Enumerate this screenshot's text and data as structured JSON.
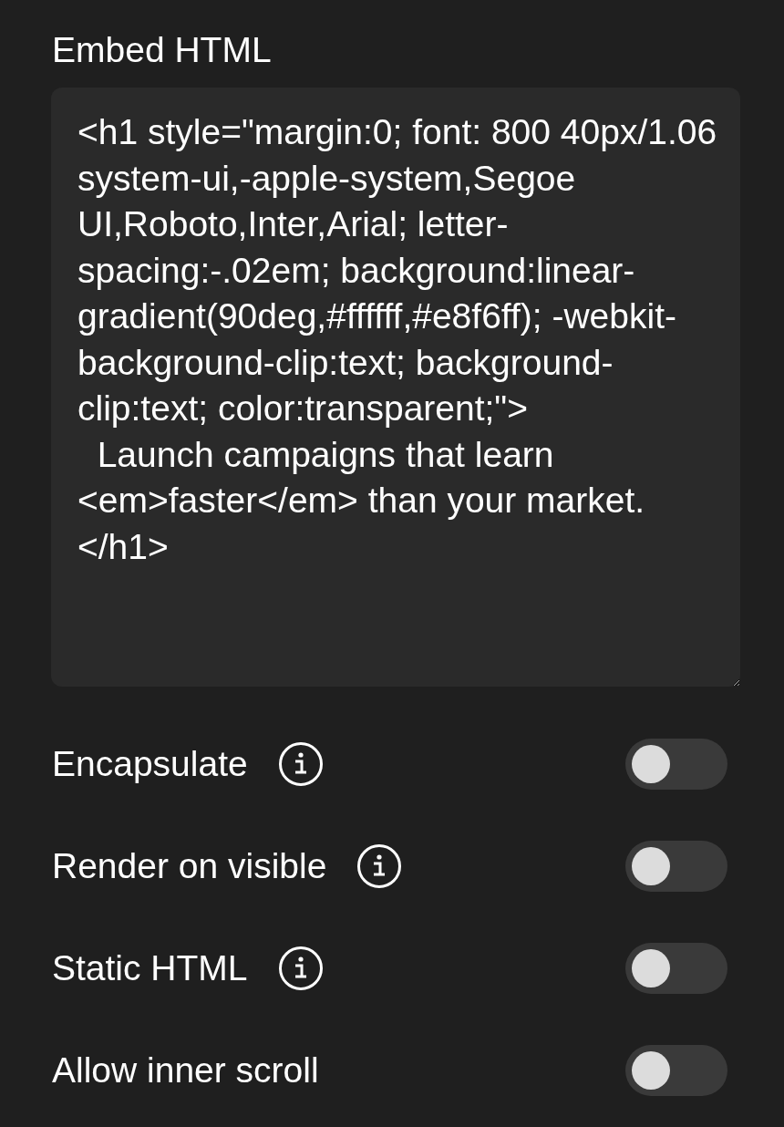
{
  "section_title": "Embed HTML",
  "html_editor": {
    "value": "<h1 style=\"margin:0; font: 800 40px/1.06 system-ui,-apple-system,Segoe UI,Roboto,Inter,Arial; letter-spacing:-.02em; background:linear-gradient(90deg,#ffffff,#e8f6ff); -webkit-background-clip:text; background-clip:text; color:transparent;\">\n  Launch campaigns that learn\n<em>faster</em> than your market.\n</h1>"
  },
  "options": [
    {
      "label": "Encapsulate",
      "info": true,
      "on": false
    },
    {
      "label": "Render on visible",
      "info": true,
      "on": false
    },
    {
      "label": "Static HTML",
      "info": true,
      "on": false
    },
    {
      "label": "Allow inner scroll",
      "info": false,
      "on": false
    }
  ]
}
